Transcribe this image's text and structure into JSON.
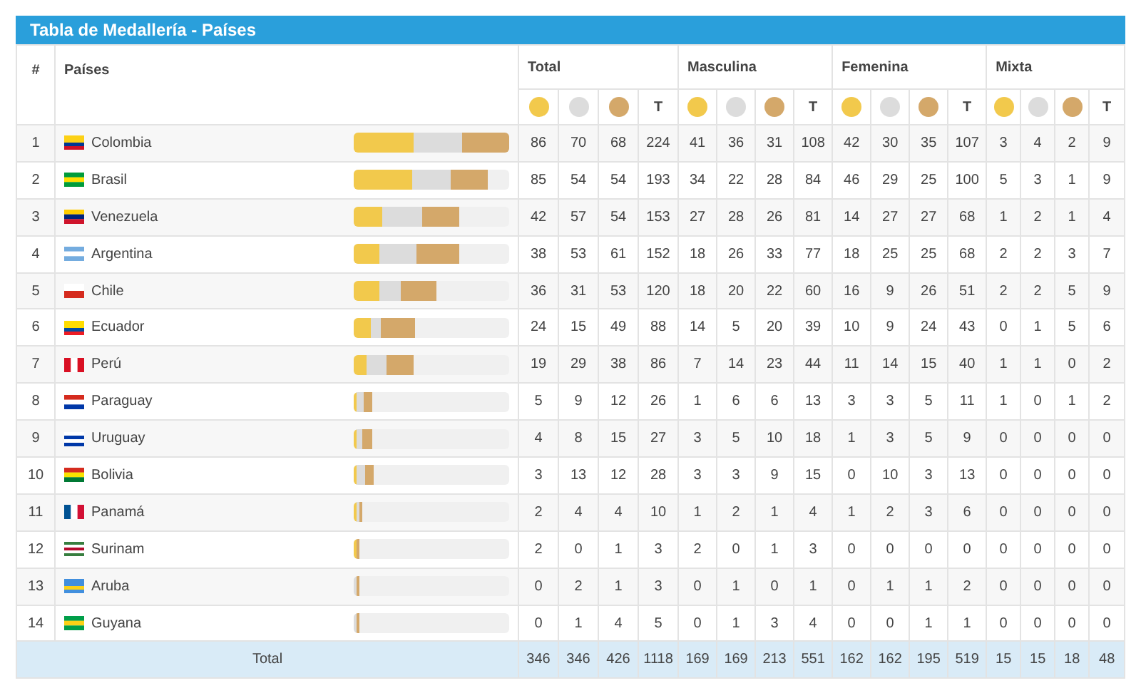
{
  "title": "Tabla de Medallería - Países",
  "table": {
    "rank_header": "#",
    "country_header": "Países",
    "groups": [
      {
        "label": "Total",
        "headers": [
          {
            "kind": "gold"
          },
          {
            "kind": "silver"
          },
          {
            "kind": "bronze"
          },
          {
            "kind": "total",
            "label": "T"
          }
        ]
      },
      {
        "label": "Masculina",
        "headers": [
          {
            "kind": "gold"
          },
          {
            "kind": "silver"
          },
          {
            "kind": "bronze"
          },
          {
            "kind": "total",
            "label": "T"
          }
        ]
      },
      {
        "label": "Femenina",
        "headers": [
          {
            "kind": "gold"
          },
          {
            "kind": "silver"
          },
          {
            "kind": "bronze"
          },
          {
            "kind": "total",
            "label": "T"
          }
        ]
      },
      {
        "label": "Mixta",
        "headers": [
          {
            "kind": "gold"
          },
          {
            "kind": "silver"
          },
          {
            "kind": "bronze"
          },
          {
            "kind": "total",
            "label": "T"
          }
        ]
      }
    ],
    "rows": [
      {
        "rank": "1",
        "country": "Colombia",
        "values": [
          "86",
          "70",
          "68",
          "224",
          "41",
          "36",
          "31",
          "108",
          "42",
          "30",
          "35",
          "107",
          "3",
          "4",
          "2",
          "9"
        ]
      },
      {
        "rank": "2",
        "country": "Brasil",
        "values": [
          "85",
          "54",
          "54",
          "193",
          "34",
          "22",
          "28",
          "84",
          "46",
          "29",
          "25",
          "100",
          "5",
          "3",
          "1",
          "9"
        ]
      },
      {
        "rank": "3",
        "country": "Venezuela",
        "values": [
          "42",
          "57",
          "54",
          "153",
          "27",
          "28",
          "26",
          "81",
          "14",
          "27",
          "27",
          "68",
          "1",
          "2",
          "1",
          "4"
        ]
      },
      {
        "rank": "4",
        "country": "Argentina",
        "values": [
          "38",
          "53",
          "61",
          "152",
          "18",
          "26",
          "33",
          "77",
          "18",
          "25",
          "25",
          "68",
          "2",
          "2",
          "3",
          "7"
        ]
      },
      {
        "rank": "5",
        "country": "Chile",
        "values": [
          "36",
          "31",
          "53",
          "120",
          "18",
          "20",
          "22",
          "60",
          "16",
          "9",
          "26",
          "51",
          "2",
          "2",
          "5",
          "9"
        ]
      },
      {
        "rank": "6",
        "country": "Ecuador",
        "values": [
          "24",
          "15",
          "49",
          "88",
          "14",
          "5",
          "20",
          "39",
          "10",
          "9",
          "24",
          "43",
          "0",
          "1",
          "5",
          "6"
        ]
      },
      {
        "rank": "7",
        "country": "Perú",
        "values": [
          "19",
          "29",
          "38",
          "86",
          "7",
          "14",
          "23",
          "44",
          "11",
          "14",
          "15",
          "40",
          "1",
          "1",
          "0",
          "2"
        ]
      },
      {
        "rank": "8",
        "country": "Paraguay",
        "values": [
          "5",
          "9",
          "12",
          "26",
          "1",
          "6",
          "6",
          "13",
          "3",
          "3",
          "5",
          "11",
          "1",
          "0",
          "1",
          "2"
        ]
      },
      {
        "rank": "9",
        "country": "Uruguay",
        "values": [
          "4",
          "8",
          "15",
          "27",
          "3",
          "5",
          "10",
          "18",
          "1",
          "3",
          "5",
          "9",
          "0",
          "0",
          "0",
          "0"
        ]
      },
      {
        "rank": "10",
        "country": "Bolivia",
        "values": [
          "3",
          "13",
          "12",
          "28",
          "3",
          "3",
          "9",
          "15",
          "0",
          "10",
          "3",
          "13",
          "0",
          "0",
          "0",
          "0"
        ]
      },
      {
        "rank": "11",
        "country": "Panamá",
        "values": [
          "2",
          "4",
          "4",
          "10",
          "1",
          "2",
          "1",
          "4",
          "1",
          "2",
          "3",
          "6",
          "0",
          "0",
          "0",
          "0"
        ]
      },
      {
        "rank": "12",
        "country": "Surinam",
        "values": [
          "2",
          "0",
          "1",
          "3",
          "2",
          "0",
          "1",
          "3",
          "0",
          "0",
          "0",
          "0",
          "0",
          "0",
          "0",
          "0"
        ]
      },
      {
        "rank": "13",
        "country": "Aruba",
        "values": [
          "0",
          "2",
          "1",
          "3",
          "0",
          "1",
          "0",
          "1",
          "0",
          "1",
          "1",
          "2",
          "0",
          "0",
          "0",
          "0"
        ]
      },
      {
        "rank": "14",
        "country": "Guyana",
        "values": [
          "0",
          "1",
          "4",
          "5",
          "0",
          "1",
          "3",
          "4",
          "0",
          "0",
          "1",
          "1",
          "0",
          "0",
          "0",
          "0"
        ]
      }
    ],
    "total_row": {
      "label": "Total",
      "values": [
        "346",
        "346",
        "426",
        "1118",
        "169",
        "169",
        "213",
        "551",
        "162",
        "162",
        "195",
        "519",
        "15",
        "15",
        "18",
        "48"
      ]
    }
  }
}
